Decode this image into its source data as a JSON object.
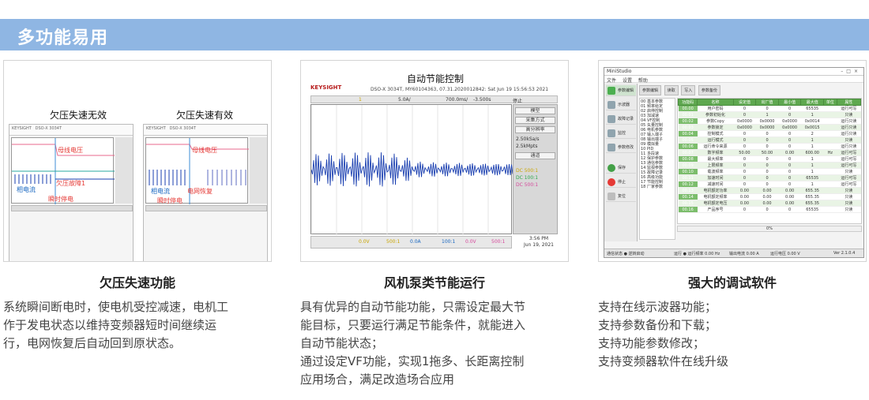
{
  "section": {
    "title": "多功能易用"
  },
  "features": [
    {
      "title": "欠压失速功能",
      "description": [
        "系统瞬间断电时，使电机受控减速，电机工",
        "作于发电状态以维持变频器短时间继续运",
        "行，电网恢复后自动回到原状态。"
      ],
      "image": {
        "left_caption": "欠压失速无效",
        "right_caption": "欠压失速有效",
        "left_tags": {
          "bus_voltage": "母线电压",
          "undervoltage_fault": "欠压故障1",
          "phase_current": "相电流",
          "instant_outage": "瞬时停电"
        },
        "right_tags": {
          "bus_voltage": "母线电压",
          "phase_current": "相电流",
          "grid_recovery": "电网恢复",
          "instant_outage": "瞬时停电"
        }
      }
    },
    {
      "title": "风机泵类节能运行",
      "description": [
        "具有优异的自动节能功能，只需设定最大节",
        "能目标，只要运行满足节能条件，就能进入",
        "自动节能状态；",
        "通过设定VF功能，实现1拖多、长距离控制",
        "应用场合，满足改造场合应用"
      ],
      "image": {
        "title": "自动节能控制",
        "brand": "KEYSIGHT",
        "scope_header": "DSO-X 3034T, MY60104363, 07.31.2020012842: Sat Jun 19 15:56:53 2021",
        "top_bar": {
          "ch": "1",
          "scale": "5.0A/",
          "timebase": "700.0ms/",
          "offset": "-3.500s",
          "trigger": "停止"
        },
        "side_buttons": [
          "模型",
          "采集方式",
          "高分辨率"
        ],
        "side_text": {
          "rate": "2.50kSa/s  2.5kMpts",
          "mode": "通道"
        },
        "side_readouts": [
          "DC  500:1",
          "DC  100:1",
          "DC  500:1"
        ],
        "bottom_bar": [
          "0.0V",
          "500:1",
          "0.0A",
          "100:1",
          "0.0V",
          "500:1"
        ],
        "time": "3:56 PM",
        "date": "Jun 19, 2021"
      }
    },
    {
      "title": "强大的调试软件",
      "description": [
        "支持在线示波器功能；",
        "支持参数备份和下载；",
        "支持功能参数修改；",
        "支持变频器软件在线升级"
      ],
      "image": {
        "app_title": "MiniStudio",
        "menu": [
          "文件",
          "设置",
          "帮助"
        ],
        "tabs": [
          "参数编辑",
          "读取",
          "写入",
          "参数备份"
        ],
        "nav": [
          "参数编辑",
          "示波器",
          "故障记录",
          "监控",
          "参数修改",
          "保存",
          "停止",
          "复位"
        ],
        "table_headers": [
          "功能码",
          "名称",
          "设定值",
          "出厂值",
          "最小值",
          "最大值",
          "单位",
          "属性"
        ],
        "rows": [
          [
            "00.00",
            "用户密码",
            "0",
            "0",
            "0",
            "65535",
            "",
            "运行可写"
          ],
          [
            "00.01",
            "参数初始化",
            "0",
            "1",
            "0",
            "1",
            "",
            "只读"
          ],
          [
            "00.02",
            "参数Copy",
            "0x0000",
            "0x0000",
            "0x0000",
            "0x0014",
            "",
            "运行只读"
          ],
          [
            "00.03",
            "参数锁定",
            "0x0000",
            "0x0000",
            "0x0000",
            "0x0015",
            "",
            "运行只读"
          ],
          [
            "00.04",
            "控制模式",
            "0",
            "0",
            "0",
            "2",
            "",
            "运行只读"
          ],
          [
            "00.05",
            "运行模式",
            "0",
            "0",
            "0",
            "1",
            "",
            "只读"
          ],
          [
            "00.06",
            "运行命令来源",
            "0",
            "0",
            "0",
            "1",
            "",
            "运行只读"
          ],
          [
            "00.07",
            "数字频率",
            "50.00",
            "50.00",
            "0.00",
            "600.00",
            "Hz",
            "运行可写"
          ],
          [
            "00.08",
            "最大频率",
            "0",
            "0",
            "0",
            "1",
            "",
            "运行可写"
          ],
          [
            "00.09",
            "上限频率",
            "0",
            "0",
            "0",
            "1",
            "",
            "运行可写"
          ],
          [
            "00.10",
            "载波频率",
            "0",
            "0",
            "0",
            "1",
            "",
            "只读"
          ],
          [
            "00.11",
            "加速时间",
            "0",
            "0",
            "0",
            "65535",
            "",
            "运行可写"
          ],
          [
            "00.12",
            "减速时间",
            "0",
            "0",
            "0",
            "1",
            "",
            "运行可写"
          ],
          [
            "00.13",
            "电机额定功率",
            "0.00",
            "0.00",
            "0.00",
            "655.35",
            "",
            "只读"
          ],
          [
            "00.14",
            "电机额定频率",
            "0.00",
            "0.00",
            "0.00",
            "655.35",
            "",
            "只读"
          ],
          [
            "00.15",
            "电机额定电压",
            "0.00",
            "0.00",
            "0.00",
            "655.35",
            "",
            "只读"
          ],
          [
            "00.16",
            "产品序号",
            "0",
            "0",
            "0",
            "65535",
            "",
            "只读"
          ]
        ],
        "progress": "0%",
        "status": {
          "left": "通信状态 ● 逆转启动",
          "mid1": "运行 ● 运行频率 0.00 Hz",
          "mid2": "输出电流 0.00 A",
          "mid3": "运行电压 0.00 V",
          "version": "Ver 2.1.0.4"
        }
      }
    }
  ],
  "colors": {
    "banner": "#8fb6e3",
    "accent_red": "#e53935",
    "wave_blue": "#1a3fb0",
    "grid_green": "#5ea84f"
  }
}
